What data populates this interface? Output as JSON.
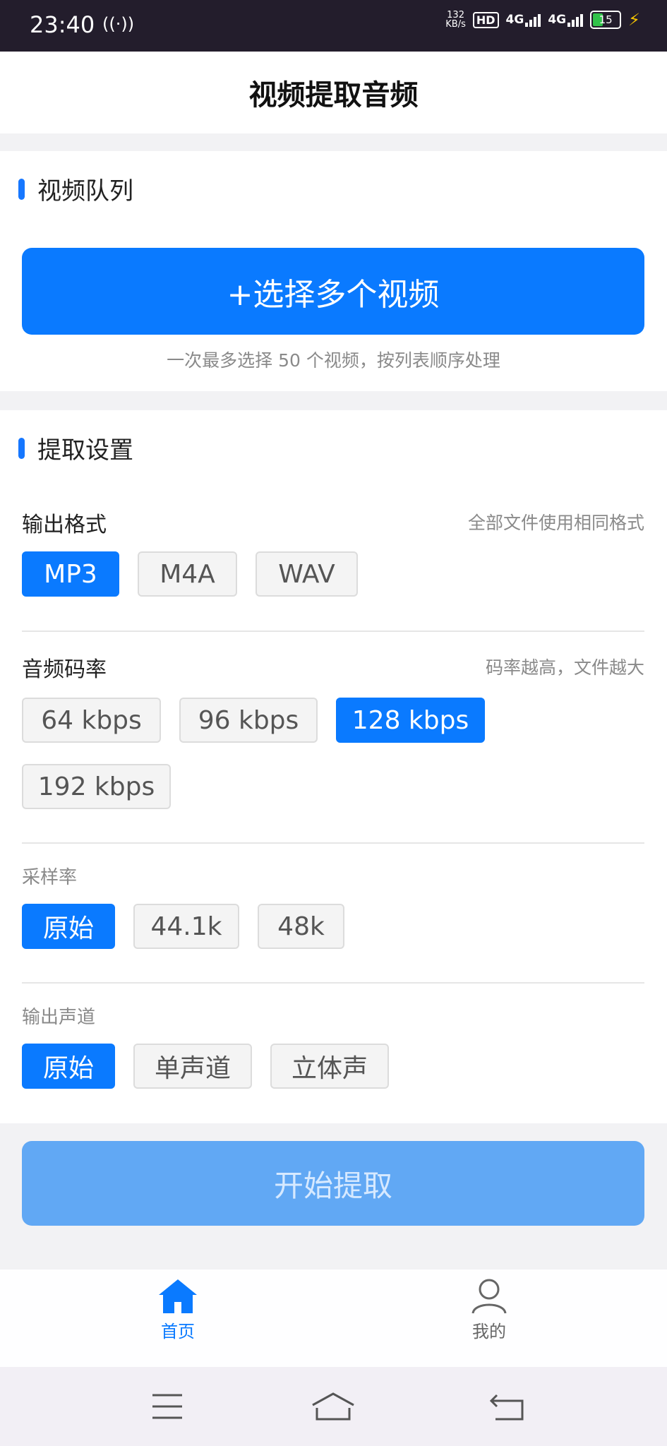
{
  "status_bar": {
    "time": "23:40",
    "speed_value": "132",
    "speed_unit": "KB/s",
    "hd": "HD",
    "net1": "4G",
    "net2": "4G",
    "battery": "15"
  },
  "header": {
    "title": "视频提取音频"
  },
  "queue": {
    "section_title": "视频队列",
    "select_button": "+选择多个视频",
    "hint": "一次最多选择 50 个视频，按列表顺序处理"
  },
  "settings": {
    "section_title": "提取设置",
    "format": {
      "label": "输出格式",
      "note": "全部文件使用相同格式",
      "options": [
        "MP3",
        "M4A",
        "WAV"
      ],
      "selected": "MP3"
    },
    "bitrate": {
      "label": "音频码率",
      "note": "码率越高，文件越大",
      "options": [
        "64 kbps",
        "96 kbps",
        "128 kbps",
        "192 kbps"
      ],
      "selected": "128 kbps"
    },
    "sample_rate": {
      "label": "采样率",
      "options": [
        "原始",
        "44.1k",
        "48k"
      ],
      "selected": "原始"
    },
    "channels": {
      "label": "输出声道",
      "options": [
        "原始",
        "单声道",
        "立体声"
      ],
      "selected": "原始"
    }
  },
  "start_button": "开始提取",
  "tabbar": {
    "home": "首页",
    "mine": "我的"
  },
  "colors": {
    "accent": "#0a7aff",
    "start_disabled": "#61a8f4"
  }
}
